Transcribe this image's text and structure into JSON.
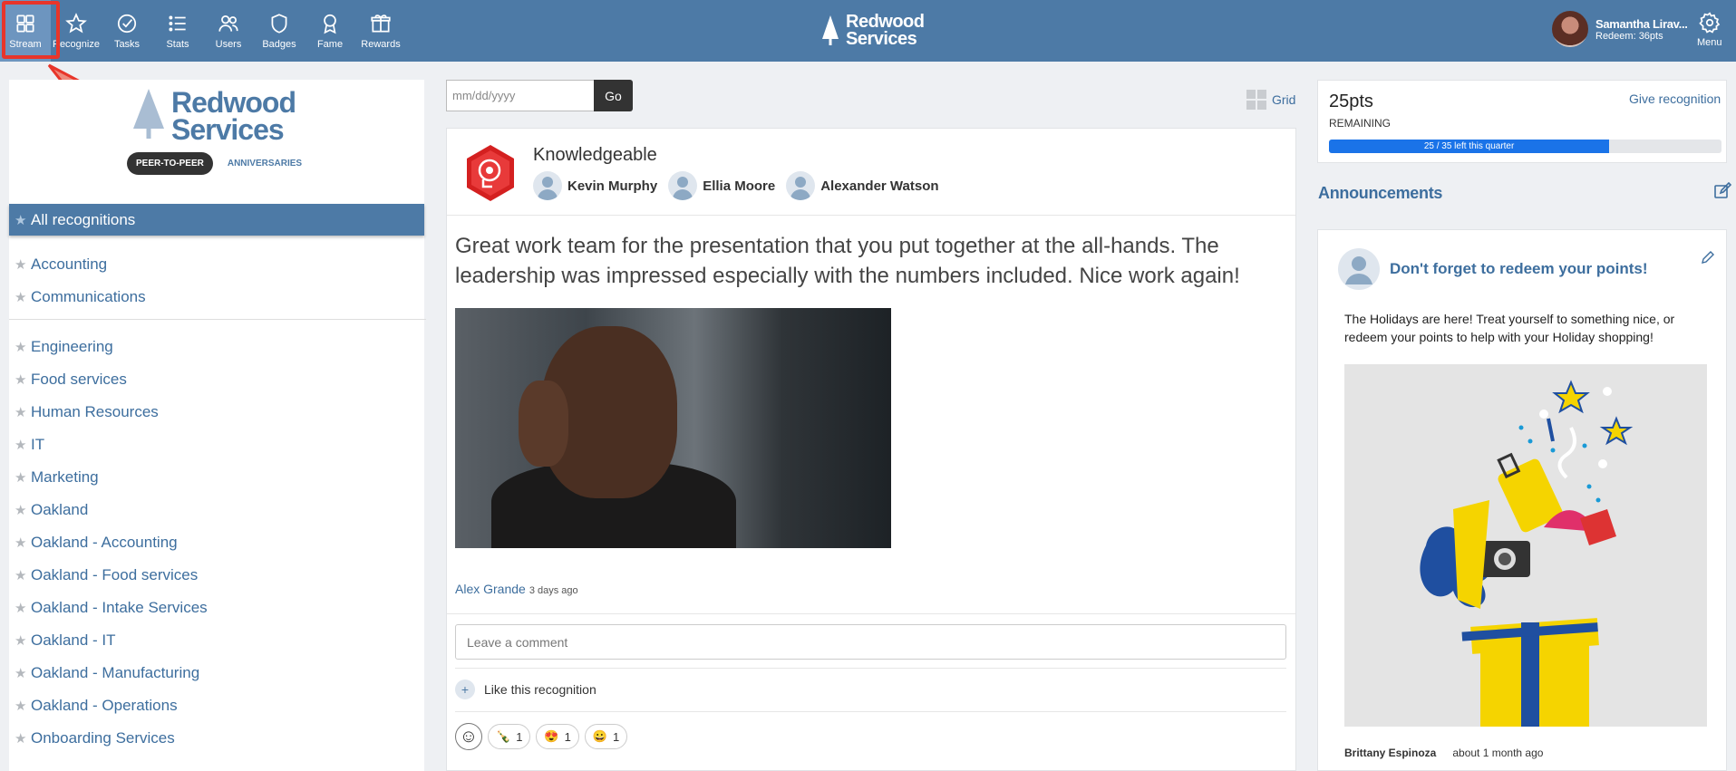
{
  "nav": {
    "items": [
      {
        "label": "Stream",
        "icon": "grid-icon"
      },
      {
        "label": "Recognize",
        "icon": "star-icon"
      },
      {
        "label": "Tasks",
        "icon": "check-circle-icon"
      },
      {
        "label": "Stats",
        "icon": "list-icon"
      },
      {
        "label": "Users",
        "icon": "users-icon"
      },
      {
        "label": "Badges",
        "icon": "shield-icon"
      },
      {
        "label": "Fame",
        "icon": "award-icon"
      },
      {
        "label": "Rewards",
        "icon": "gift-icon"
      }
    ],
    "active": "Stream"
  },
  "brand": {
    "line1": "Redwood",
    "line2": "Services"
  },
  "annotation": {
    "step": "1"
  },
  "user": {
    "name": "Samantha Lirav...",
    "redeem": "Redeem: 36pts",
    "menu_label": "Menu"
  },
  "sidebar": {
    "tabs": {
      "active": "PEER-TO-PEER",
      "other": "ANNIVERSARIES"
    },
    "all_label": "All recognitions",
    "group1": [
      "Accounting",
      "Communications"
    ],
    "group2": [
      "Engineering",
      "Food services",
      "Human Resources",
      "IT",
      "Marketing",
      "Oakland",
      "Oakland - Accounting",
      "Oakland - Food services",
      "Oakland - Intake Services",
      "Oakland - IT",
      "Oakland - Manufacturing",
      "Oakland - Operations",
      "Onboarding Services"
    ]
  },
  "filter": {
    "date_placeholder": "mm/dd/yyyy",
    "go_label": "Go",
    "grid_label": "Grid"
  },
  "post": {
    "badge": "Knowledgeable",
    "recipients": [
      "Kevin Murphy",
      "Ellia Moore",
      "Alexander Watson"
    ],
    "message": "Great work team for the presentation that you put together at the all-hands. The leadership was impressed especially with the numbers included. Nice work again!",
    "author": "Alex Grande",
    "time": "3 days ago",
    "comment_placeholder": "Leave a comment",
    "like_label": "Like this recognition",
    "reactions": [
      {
        "emoji": "🍾",
        "count": "1"
      },
      {
        "emoji": "😍",
        "count": "1"
      },
      {
        "emoji": "😀",
        "count": "1"
      }
    ]
  },
  "points": {
    "value": "25pts",
    "remaining_label": "REMAINING",
    "give_label": "Give recognition",
    "bar_label": "25 / 35 left this quarter",
    "bar_fraction": 0.714,
    "bar_color": "#1a73e8"
  },
  "announcements": {
    "title": "Announcements",
    "heading": "Don't forget to redeem your points!",
    "body": "The Holidays are here! Treat yourself to something nice, or redeem your points to help with your Holiday shopping!",
    "author": "Brittany Espinoza",
    "time": "about 1 month ago"
  },
  "colors": {
    "header": "#4d7aa6",
    "accent": "#3d6e9e",
    "annotation": "#e8352a"
  }
}
